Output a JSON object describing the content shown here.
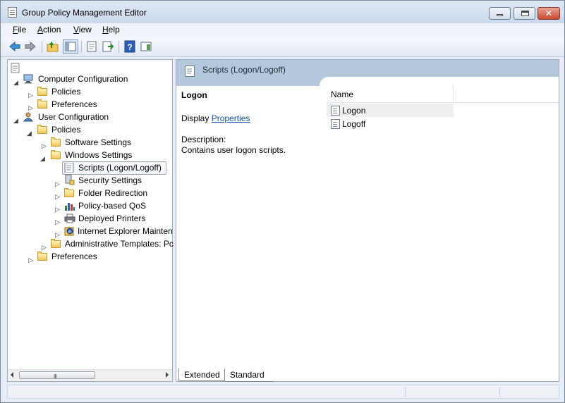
{
  "window": {
    "title": "Group Policy Management Editor"
  },
  "menu": [
    {
      "label": "File",
      "u": "F",
      "rest": "ile"
    },
    {
      "label": "Action",
      "u": "A",
      "rest": "ction"
    },
    {
      "label": "View",
      "u": "V",
      "rest": "iew"
    },
    {
      "label": "Help",
      "u": "H",
      "rest": "elp"
    }
  ],
  "tree": {
    "root": "",
    "items": [
      {
        "label": "Computer Configuration"
      },
      {
        "label": "Policies"
      },
      {
        "label": "Preferences"
      },
      {
        "label": "User Configuration"
      },
      {
        "label": "Policies"
      },
      {
        "label": "Software Settings"
      },
      {
        "label": "Windows Settings"
      },
      {
        "label": "Scripts (Logon/Logoff)"
      },
      {
        "label": "Security Settings"
      },
      {
        "label": "Folder Redirection"
      },
      {
        "label": "Policy-based QoS"
      },
      {
        "label": "Deployed Printers"
      },
      {
        "label": "Internet Explorer Mainten"
      },
      {
        "label": "Administrative Templates: Pc"
      },
      {
        "label": "Preferences"
      }
    ]
  },
  "detail": {
    "header_title": "Scripts (Logon/Logoff)",
    "selected_title": "Logon",
    "display_prefix": "Display",
    "properties_link": "Properties",
    "description_label": "Description:",
    "description_text": "Contains user logon scripts."
  },
  "list": {
    "column_name": "Name",
    "rows": [
      {
        "label": "Logon"
      },
      {
        "label": "Logoff"
      }
    ]
  },
  "tabs": {
    "extended": "Extended",
    "standard": "Standard"
  },
  "scrollbar": {
    "grip": "III"
  },
  "caption_buttons": {
    "close_glyph": "✕"
  }
}
